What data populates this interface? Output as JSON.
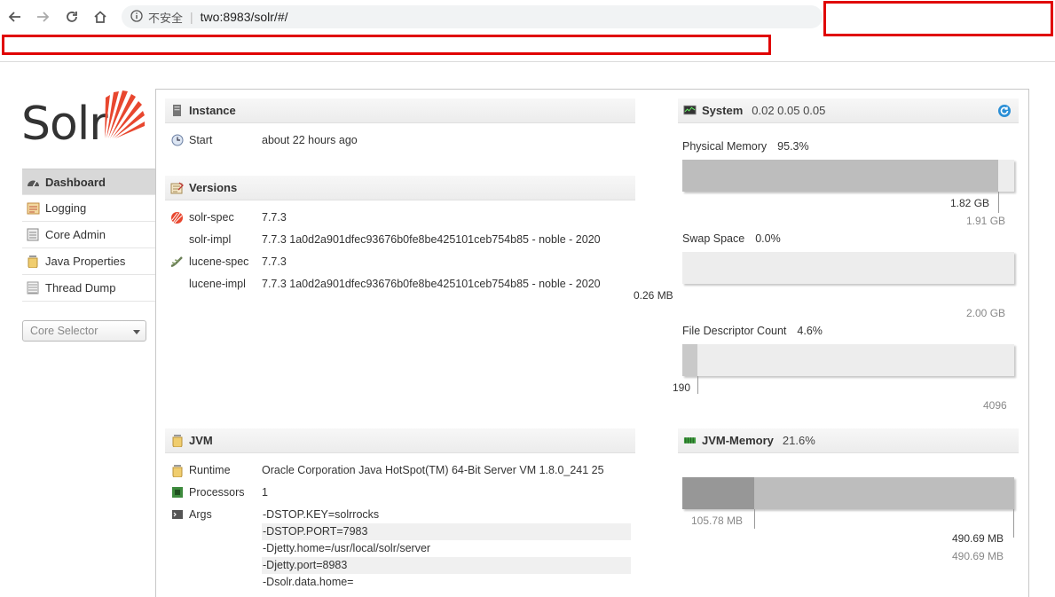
{
  "browser": {
    "security_label": "不安全",
    "url": "two:8983/solr/#/"
  },
  "logo": {
    "word": "Solr"
  },
  "sidebar": {
    "items": [
      {
        "label": "Dashboard",
        "icon": "dashboard-icon",
        "active": true
      },
      {
        "label": "Logging",
        "icon": "logging-icon"
      },
      {
        "label": "Core Admin",
        "icon": "core-admin-icon"
      },
      {
        "label": "Java Properties",
        "icon": "java-properties-icon"
      },
      {
        "label": "Thread Dump",
        "icon": "thread-dump-icon"
      }
    ],
    "core_selector": "Core Selector"
  },
  "instance": {
    "title": "Instance",
    "start_label": "Start",
    "start_value": "about 22 hours ago"
  },
  "versions": {
    "title": "Versions",
    "rows": [
      {
        "label": "solr-spec",
        "value": "7.7.3"
      },
      {
        "label": "solr-impl",
        "value": "7.7.3 1a0d2a901dfec93676b0fe8be425101ceb754b85 - noble - 2020"
      },
      {
        "label": "lucene-spec",
        "value": "7.7.3"
      },
      {
        "label": "lucene-impl",
        "value": "7.7.3 1a0d2a901dfec93676b0fe8be425101ceb754b85 - noble - 2020"
      }
    ]
  },
  "jvm": {
    "title": "JVM",
    "runtime_label": "Runtime",
    "runtime_value": "Oracle Corporation Java HotSpot(TM) 64-Bit Server VM 1.8.0_241 25",
    "processors_label": "Processors",
    "processors_value": "1",
    "args_label": "Args",
    "args": [
      "-DSTOP.KEY=solrrocks",
      "-DSTOP.PORT=7983",
      "-Djetty.home=/usr/local/solr/server",
      "-Djetty.port=8983",
      "-Dsolr.data.home="
    ]
  },
  "system": {
    "title": "System",
    "load": "0.02 0.05 0.05",
    "physical": {
      "label": "Physical Memory",
      "pct": "95.3%",
      "fraction": 0.953,
      "used": "1.82 GB",
      "total": "1.91 GB"
    },
    "swap": {
      "label": "Swap Space",
      "pct": "0.0%",
      "fraction": 0.0,
      "used": "0.26 MB",
      "total": "2.00 GB"
    },
    "fd": {
      "label": "File Descriptor Count",
      "pct": "4.6%",
      "fraction": 0.046,
      "used": "190",
      "total": "4096"
    }
  },
  "jvm_memory": {
    "title": "JVM-Memory",
    "pct": "21.6%",
    "used_fraction": 0.216,
    "used": "105.78 MB",
    "max": "490.69 MB",
    "total": "490.69 MB"
  },
  "colors": {
    "redact": "#e00000",
    "logo": "#e8472f"
  }
}
